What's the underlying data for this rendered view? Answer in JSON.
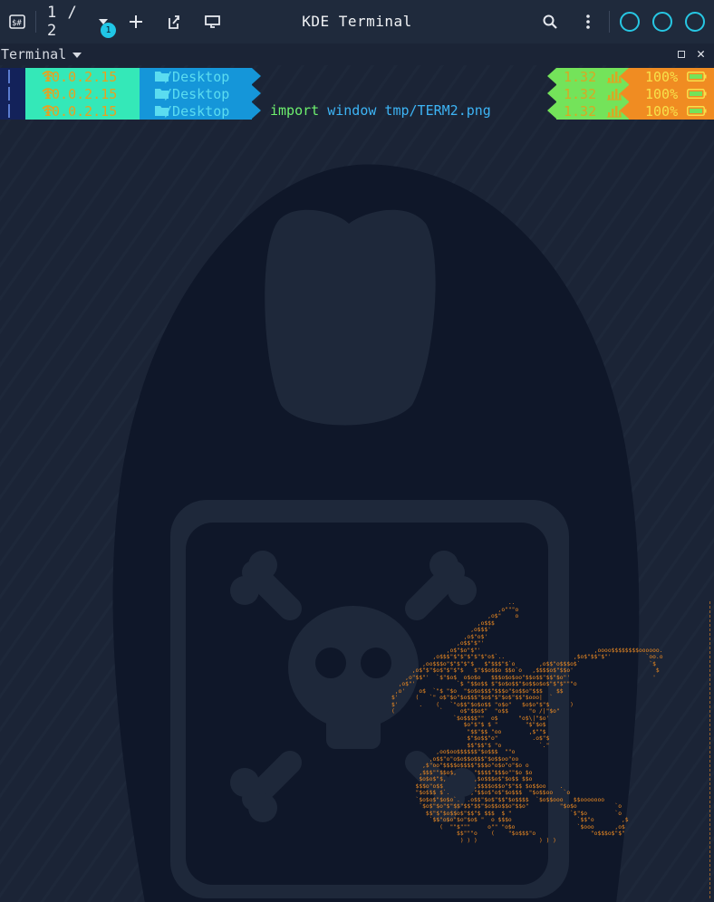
{
  "window": {
    "title": "KDE Terminal"
  },
  "toolbar": {
    "tab_counter": "1 / 2",
    "tab_badge": "1"
  },
  "icons": [
    "split-view-icon",
    "chevron-down-icon",
    "plus-icon",
    "detach-tab-icon",
    "display-icon",
    "search-icon",
    "kebab-menu-icon"
  ],
  "subheader": {
    "title": "Terminal"
  },
  "prompt": {
    "ip": "10.0.2.15",
    "dir": "~/Desktop",
    "load": "1.32",
    "battery": "100%"
  },
  "lines": [
    {
      "cmd_keyword": "",
      "cmd_args": ""
    },
    {
      "cmd_keyword": "",
      "cmd_args": ""
    },
    {
      "cmd_keyword": "import",
      "cmd_args": "window tmp/TERM2.png"
    }
  ],
  "colors": {
    "accent": "#27c7e3",
    "ip_bg": "#34e8b8",
    "dir_bg": "#1596d9",
    "load_bg": "#74e35a",
    "battery_bg": "#f08c22",
    "ascii": "#f08c22"
  },
  "ascii_art": "                                  ..\n                               ,o\"\"\"o\n                            ,o$\"    o\n                         ,o$$$\n                       ,o$$$'\n                     ,o$\"o$'\n                   ,o$$\"$\"'\n                ,o$\"$o\"$\"'                                 ,oooo$$$$$$$$oooooo.\n            ,o$$$\"$\"$\"$\"$\"$\"o$`..                    ,$o$\"$$\"$\"'          `oo.o\n         ,oo$$$o\"$\"$\"$\"$   $\"$$$\"$`o       ,o$$\"o$$$o$`                    `$\n      ,o$\"$\"$o$\"$\"$\"$   $\"$$o$$o $$o`o   ,$$$$o$\"$$o'                        $\n    ,o\"$$\"'  `$\"$o$  o$o$o   $$$o$o$oo\"$$o$$\"$$\"$o\"'                        '\n  ,o$\"'            `$ \"$$o$$ $\"$o$o$$\"$o$$o$o$\"$\"$\"\"\"o\n ,o'    o$  `\"$ \"$o  \"$o$o$$$\"$$$o\"$o$$o\"$$$    $$\n$'     (   `\" o$\"$o\"$o$$$\"$o$\"$\"$o$\"$$\"$ooo|  `\n$'      .    (   `\"o$$\"$o$o$$ \"o$o\"   $o$o\"$\"$      )\n(             `     o$\"$$o$\"  \"o$$      \"o /|\"$o\"\n                  `$o$$$$\"\"  o$      \"o$\\|\"$o'\n                     $o\"$\"$ $ \"        \"$\"$o$\n                      \"$$\"$$ \"oo        ,$\"\"$\n                      $\"$o$$\"o\"          .o$\"$\n                      $$\"$$\"$ \"o           `.\"\n             ,oo$oo$$$$$$\"$o$$$  \"\"o\n           ,o$$\"o\"o$o$$o$$$\"$o$$oo\"oo\n         ,$\"oo\"$$$$o$$$$\"$$$o\"o$o\"o\"$o o\n        ,$$$\"\"$$o$,     \"$$$$\"$$$o\"\"$o $o\n        $o$o$\"$,        ,$o$$$o$\"$o$$ $$o\n       $$$o\"o$$         ,$$$$o$$o\"$\"$$ $o$$oo    .\n       \"$o$$$ $`.      ,\"$$o$\"o$\"$o$$$  \"$o$$oo   `o\n       `$o$o$\"$o$o`.  .o$$\"$o$\"$$\"$o$$$$  `$o$$ooo   $$ooooooo\n        `$o$\"$o\"$\"$$\"$$\"$$\"$o$$o$$o\"$$o\"         \"$o$o           `o\n          $$\"$\"$o$$o$\"$$\"$ $$$  $ \"                 `$\"$o        `o\n           `$$\"o$o\"$o\"$o$ \"  o $$$o                   `$$\"o        ,$\n              (  \"\"$\"\"\"     o\"\" \"o$o                  `$ooo      ,o$\n                   $$\"\"\"o    (    \"$o$$$\"o                \"o$$$o$\"$\"\n                    ) ) )                  ) ) )"
}
